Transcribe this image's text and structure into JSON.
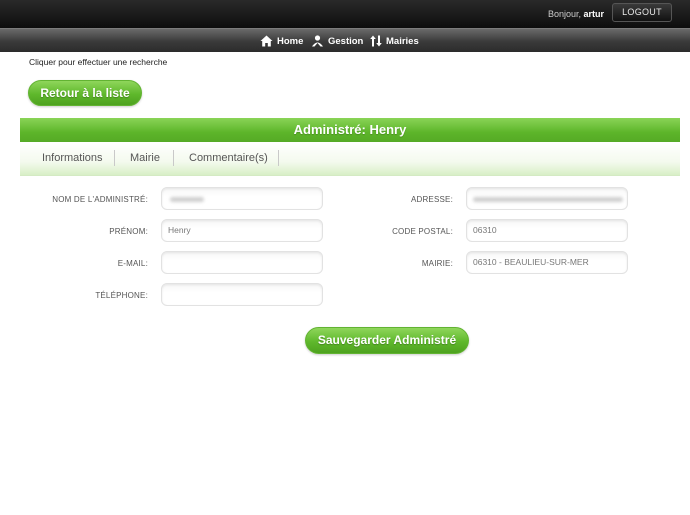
{
  "header": {
    "greeting_prefix": "Bonjour,",
    "username": "artur",
    "logout_label": "LOGOUT"
  },
  "nav": {
    "items": [
      {
        "label": "Home",
        "icon": "home-icon"
      },
      {
        "label": "Gestion",
        "icon": "people-icon"
      },
      {
        "label": "Mairies",
        "icon": "sort-arrows-icon"
      }
    ]
  },
  "search_hint": "Cliquer pour effectuer une recherche",
  "back_button": "Retour à la liste",
  "page_title": "Administré: Henry",
  "tabs": [
    "Informations",
    "Mairie",
    "Commentaire(s)"
  ],
  "form": {
    "nom": {
      "label": "NOM DE L'ADMINISTRÉ:",
      "value": ""
    },
    "prenom": {
      "label": "PRÉNOM:",
      "value": "Henry"
    },
    "email": {
      "label": "E-MAIL:",
      "value": ""
    },
    "telephone": {
      "label": "TÉLÉPHONE:",
      "value": ""
    },
    "adresse": {
      "label": "ADRESSE:",
      "value": ""
    },
    "code_postal": {
      "label": "CODE POSTAL:",
      "value": "06310"
    },
    "mairie": {
      "label": "MAIRIE:",
      "value": "06310 - BEAULIEU-SUR-MER"
    }
  },
  "save_button": "Sauvegarder Administré",
  "colors": {
    "accent_green": "#5db52a",
    "topbar": "#111111"
  }
}
